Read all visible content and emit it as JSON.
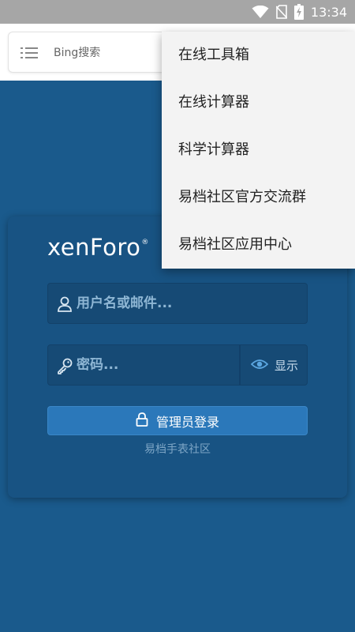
{
  "status_bar": {
    "time": "13:34",
    "icons": [
      "wifi-icon",
      "no-sim-icon",
      "battery-charging-icon"
    ]
  },
  "browser": {
    "menu_icon": "list-menu-icon",
    "search_placeholder": "Bing搜索"
  },
  "login": {
    "logo_text": "xenForo",
    "logo_mark": "®",
    "username_placeholder": "用户名或邮件...",
    "password_placeholder": "密码...",
    "show_password_label": "显示",
    "login_button_label": "管理员登录",
    "footer_text": "易档手表社区"
  },
  "dropdown": {
    "items": [
      {
        "label": "在线工具箱"
      },
      {
        "label": "在线计算器"
      },
      {
        "label": "科学计算器"
      },
      {
        "label": "易档社区官方交流群"
      },
      {
        "label": "易档社区应用中心"
      }
    ]
  },
  "colors": {
    "background": "#1a5a8c",
    "card": "#185383",
    "input": "#164a75",
    "button": "#2b78ba",
    "status_bar": "#a6a6a6",
    "menu": "#f3f3f3"
  }
}
